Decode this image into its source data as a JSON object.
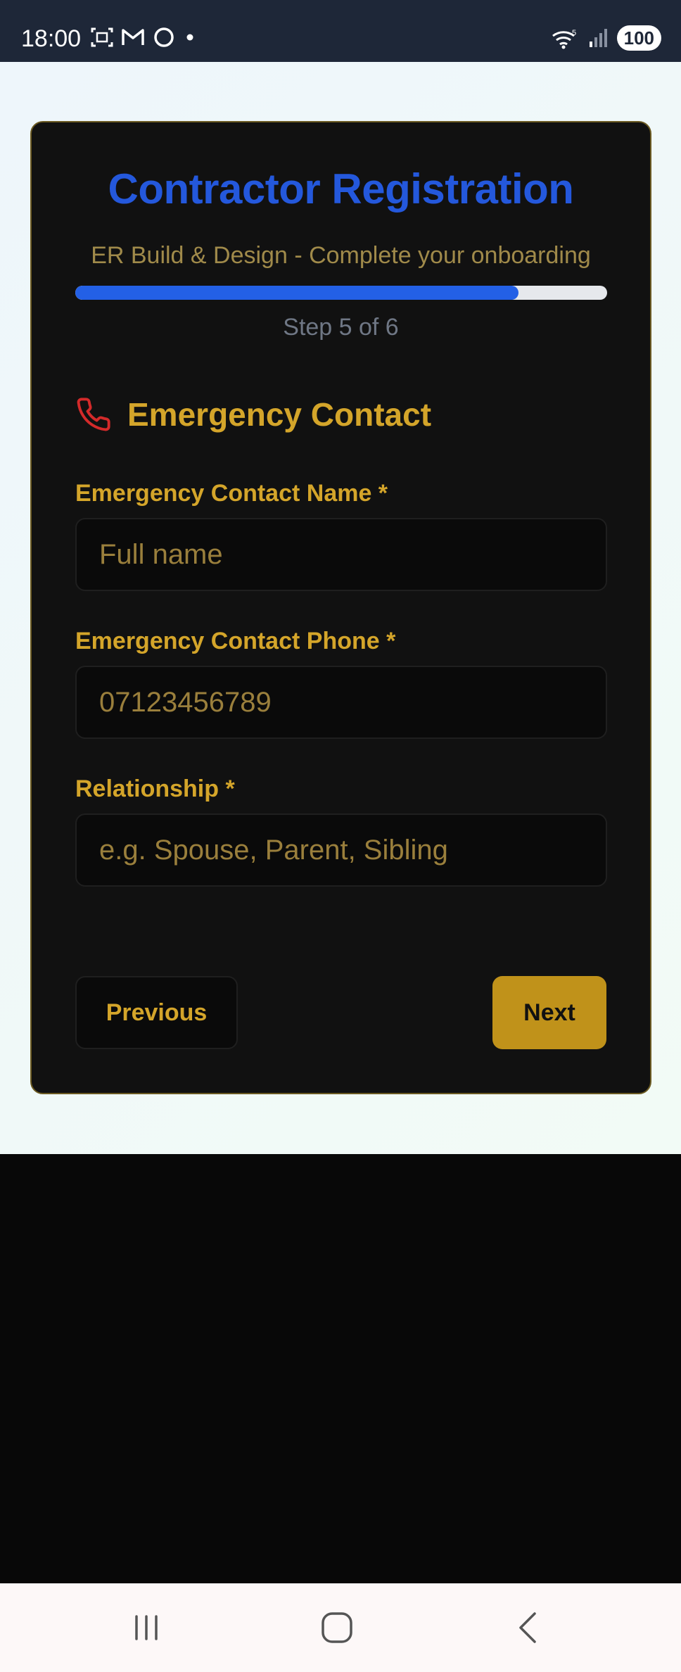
{
  "status_bar": {
    "time": "18:00",
    "battery": "100",
    "left_icons": [
      "screenshot-icon",
      "gmail-icon",
      "circle-app-icon",
      "dot-icon"
    ],
    "right_icons": [
      "wifi-icon",
      "signal-icon"
    ]
  },
  "form": {
    "title": "Contractor Registration",
    "subtitle": "ER Build & Design - Complete your onboarding",
    "progress": 0.8333,
    "step_text": "Step 5 of 6",
    "section": {
      "icon": "phone-icon",
      "title": "Emergency Contact"
    },
    "fields": [
      {
        "label": "Emergency Contact Name *",
        "placeholder": "Full name",
        "value": ""
      },
      {
        "label": "Emergency Contact Phone *",
        "placeholder": "07123456789",
        "value": ""
      },
      {
        "label": "Relationship *",
        "placeholder": "e.g. Spouse, Parent, Sibling",
        "value": ""
      }
    ],
    "buttons": {
      "previous": "Previous",
      "next": "Next"
    }
  },
  "colors": {
    "accent_blue": "#2458dc",
    "accent_gold": "#d4a52a",
    "button_gold": "#c0921a",
    "card_bg": "#111111",
    "phone_icon": "#d42a2a"
  },
  "nav_bar": {
    "buttons": [
      "recents-icon",
      "home-icon",
      "back-icon"
    ]
  }
}
